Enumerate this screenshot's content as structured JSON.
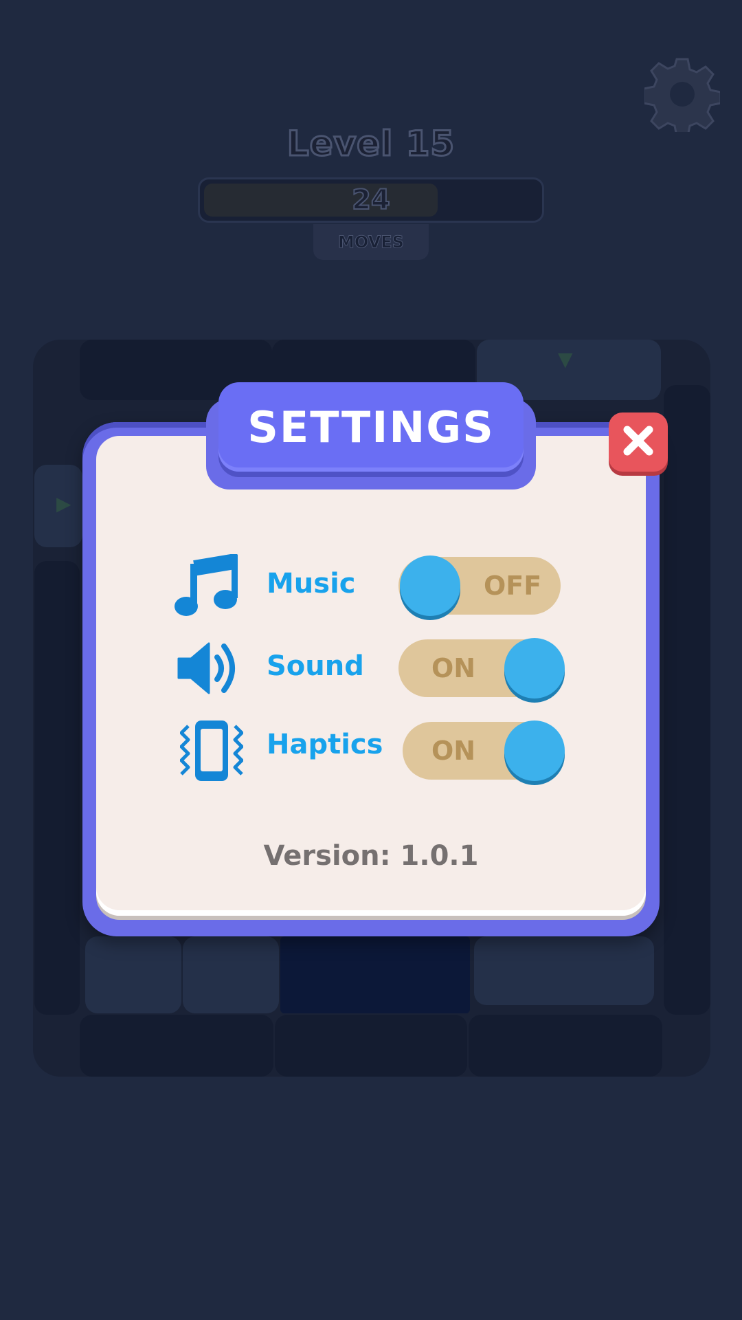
{
  "hud": {
    "level_title": "Level 15",
    "moves_count": "24",
    "moves_label": "MOVES",
    "moves_progress": 0.7,
    "settings_icon": "gear-icon"
  },
  "settings": {
    "title": "SETTINGS",
    "close_icon": "close-icon",
    "rows": [
      {
        "label": "Music",
        "icon": "music-note-icon",
        "state": "OFF"
      },
      {
        "label": "Sound",
        "icon": "speaker-icon",
        "state": "ON"
      },
      {
        "label": "Haptics",
        "icon": "vibration-phone-icon",
        "state": "ON"
      }
    ],
    "version": "Version: 1.0.1"
  },
  "colors": {
    "dialog_frame": "#6a6ce8",
    "dialog_panel": "#f6ede9",
    "label_blue": "#18a2ec",
    "knob": "#3cb1ec",
    "toggle_track": "#dfc69b",
    "close_red": "#e8555c",
    "backdrop": "#1f2940"
  }
}
